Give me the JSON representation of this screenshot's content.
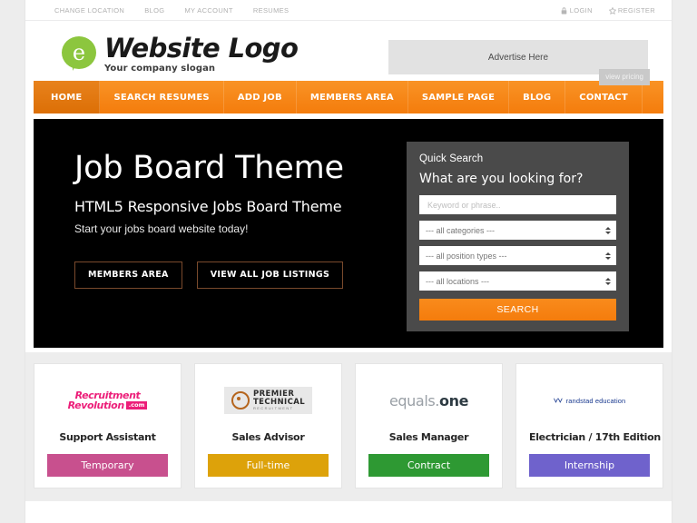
{
  "topbar": {
    "left_links": [
      {
        "label": "CHANGE LOCATION"
      },
      {
        "label": "BLOG"
      },
      {
        "label": "MY ACCOUNT"
      },
      {
        "label": "RESUMES"
      }
    ],
    "login": {
      "label": "LOGIN",
      "icon": "lock-icon"
    },
    "register": {
      "label": "REGISTER",
      "icon": "star-icon"
    }
  },
  "header": {
    "logo_letter": "e",
    "title": "Website Logo",
    "slogan": "Your company slogan",
    "ad": {
      "label": "Advertise Here",
      "button": "view pricing"
    }
  },
  "nav": {
    "items": [
      {
        "label": "HOME",
        "active": true
      },
      {
        "label": "SEARCH RESUMES",
        "active": false
      },
      {
        "label": "ADD JOB",
        "active": false
      },
      {
        "label": "MEMBERS AREA",
        "active": false
      },
      {
        "label": "SAMPLE PAGE",
        "active": false
      },
      {
        "label": "BLOG",
        "active": false
      },
      {
        "label": "CONTACT",
        "active": false
      }
    ],
    "accent_color": "#f47c0c",
    "active_color": "#dc6f06"
  },
  "hero": {
    "headline": "Job Board Theme",
    "subheadline": "HTML5 Responsive Jobs Board Theme",
    "tagline": "Start your jobs board website today!",
    "buttons": [
      {
        "label": "MEMBERS AREA"
      },
      {
        "label": "VIEW ALL JOB LISTINGS"
      }
    ],
    "background_color": "#000000"
  },
  "quick_search": {
    "title": "Quick Search",
    "subtitle": "What are you looking for?",
    "keyword_value": "",
    "keyword_placeholder": "Keyword or phrase..",
    "selects": [
      {
        "value": "--- all categories ---"
      },
      {
        "value": "--- all position types ---"
      },
      {
        "value": "--- all locations ---"
      }
    ],
    "search_button": "SEARCH",
    "panel_color": "#4a4a4a"
  },
  "job_cards": [
    {
      "logo_name": "recruitment-revolution-logo",
      "logo_line1": "Recruitment",
      "logo_line2": "Revolution",
      "logo_badge": ".com",
      "title": "Support Assistant",
      "badge": "Temporary",
      "badge_color": "#c8508e"
    },
    {
      "logo_name": "premier-technical-logo",
      "logo_line1": "PREMIER",
      "logo_line2": "TECHNICAL",
      "logo_line3": "RECRUITMENT",
      "title": "Sales Advisor",
      "badge": "Full-time",
      "badge_color": "#dda20a"
    },
    {
      "logo_name": "equals-one-logo",
      "logo_line1": "equals.",
      "logo_line2": "one",
      "title": "Sales Manager",
      "badge": "Contract",
      "badge_color": "#2e9933"
    },
    {
      "logo_name": "randstad-education-logo",
      "logo_line1": "randstad education",
      "title": "Electrician / 17th Edition",
      "badge": "Internship",
      "badge_color": "#6f62cc"
    }
  ]
}
